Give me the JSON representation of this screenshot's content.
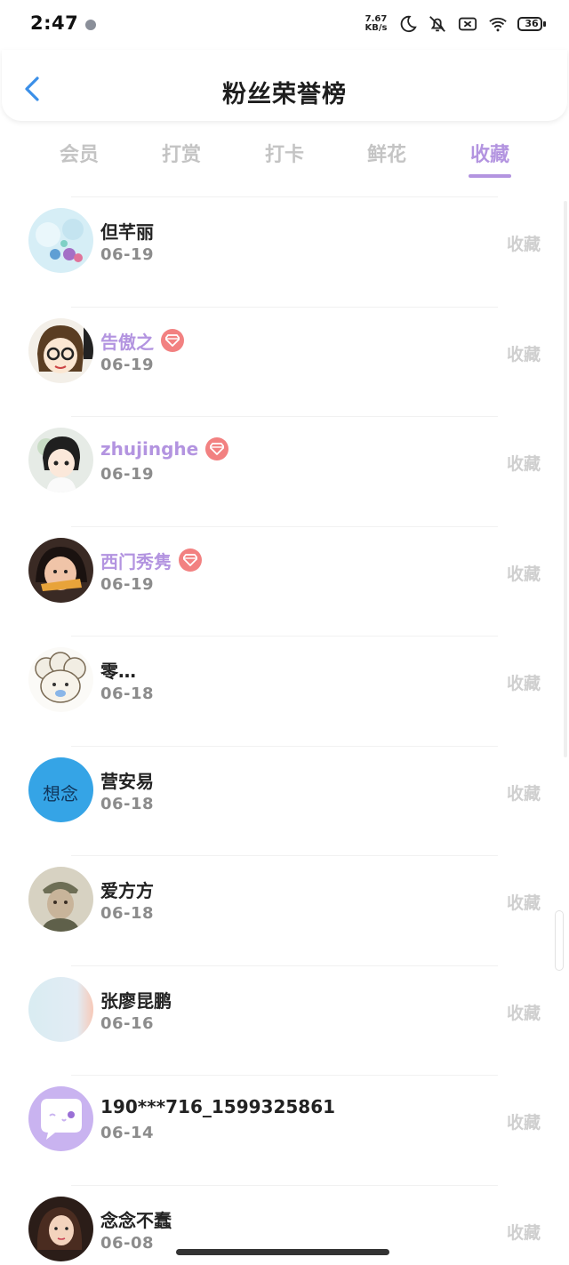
{
  "status": {
    "time": "2:47",
    "net_speed_value": "7.67",
    "net_speed_unit": "KB/s",
    "battery": "36"
  },
  "header": {
    "title": "粉丝荣誉榜"
  },
  "tabs": [
    {
      "label": "会员"
    },
    {
      "label": "打赏"
    },
    {
      "label": "打卡"
    },
    {
      "label": "鲜花"
    },
    {
      "label": "收藏",
      "active": true
    }
  ],
  "rows": [
    {
      "name": "但芊丽",
      "date": "06-19",
      "action": "收藏",
      "vip": false
    },
    {
      "name": "告傲之",
      "date": "06-19",
      "action": "收藏",
      "vip": true
    },
    {
      "name": "zhujinghe",
      "date": "06-19",
      "action": "收藏",
      "vip": true
    },
    {
      "name": "西门秀隽",
      "date": "06-19",
      "action": "收藏",
      "vip": true
    },
    {
      "name": "零…",
      "date": "06-18",
      "action": "收藏",
      "vip": false
    },
    {
      "name": "营安易",
      "date": "06-18",
      "action": "收藏",
      "vip": false,
      "avatar_text": "想念"
    },
    {
      "name": "爱方方",
      "date": "06-18",
      "action": "收藏",
      "vip": false
    },
    {
      "name": "张廖昆鹏",
      "date": "06-16",
      "action": "收藏",
      "vip": false
    },
    {
      "name": "190***716_1599325861",
      "date": "06-14",
      "action": "收藏",
      "vip": false
    },
    {
      "name": "念念不蠢",
      "date": "06-08",
      "action": "收藏",
      "vip": false
    }
  ],
  "colors": {
    "accent": "#b394e0",
    "vip_badge": "#f28181",
    "inactive_tab": "#c4c4c4",
    "date_text": "#8c8c8c"
  },
  "icons": {
    "back": "chevron-left-icon",
    "vip": "diamond-icon",
    "moon": "moon-icon",
    "mute": "bell-off-icon",
    "sim": "sim-off-icon",
    "wifi": "wifi-icon"
  }
}
